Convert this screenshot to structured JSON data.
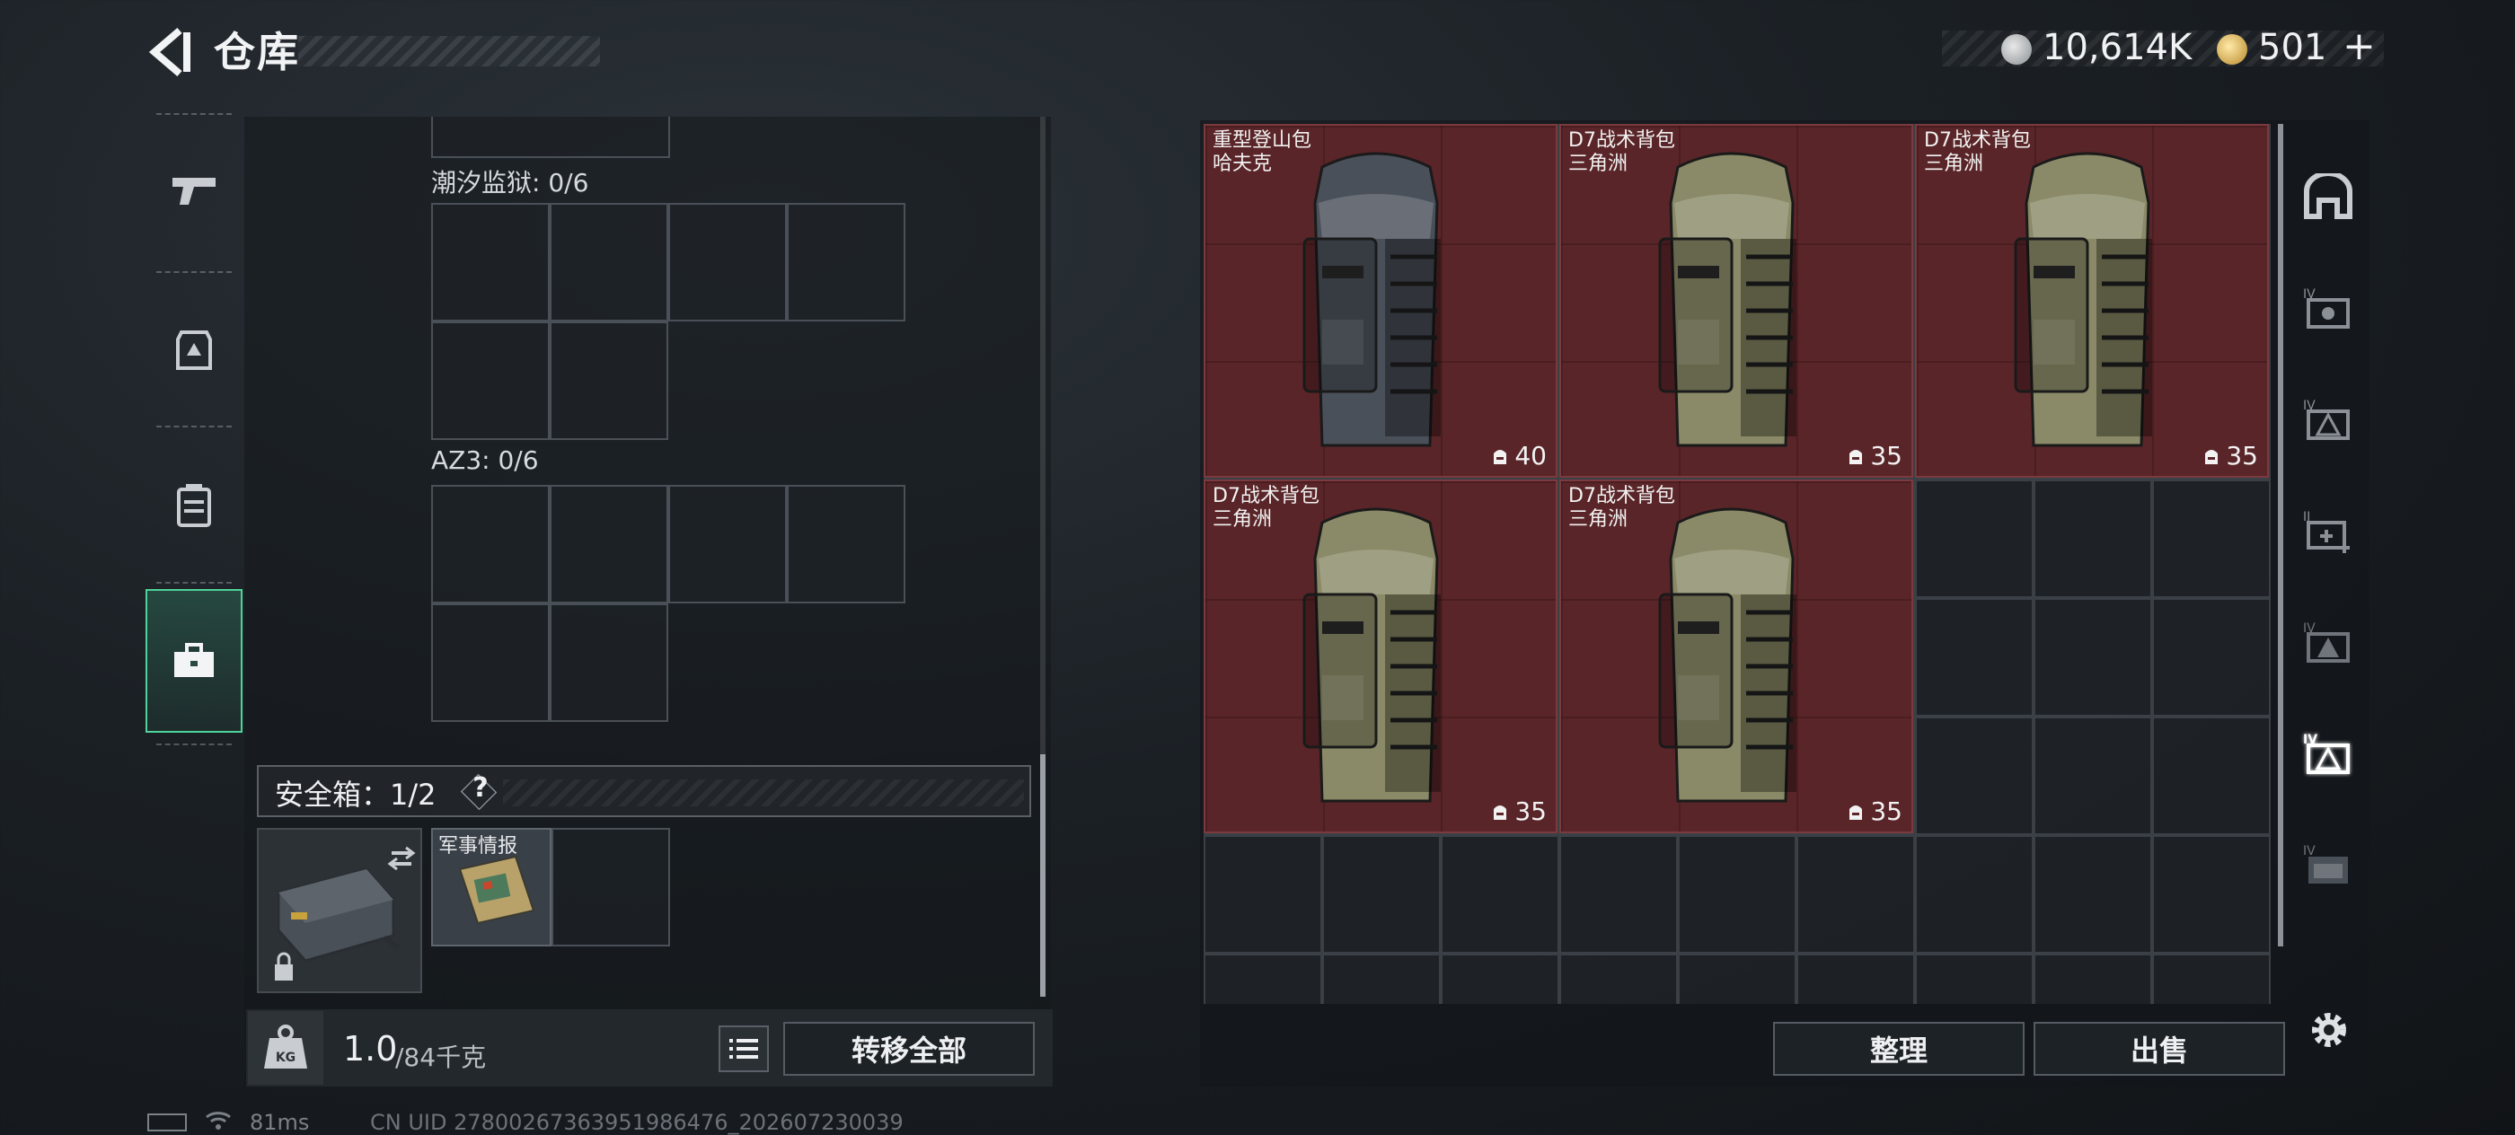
{
  "header": {
    "title": "仓库",
    "currency_primary": "10,614K",
    "currency_secondary": "501",
    "currency_secondary_plus": "+"
  },
  "left_nav": [
    "weapons-icon",
    "armor-icon",
    "backpack-icon",
    "toolbox-icon"
  ],
  "containers": {
    "grid1_label": "潮汐监狱: 0/6",
    "grid2_label": "AZ3: 0/6",
    "safebox_label": "安全箱：1/2",
    "safebox_help": "?",
    "safebox_item_label": "军事情报"
  },
  "capacity": {
    "current": "1.0",
    "max": "/84千克",
    "transfer_all": "转移全部"
  },
  "stash": {
    "items": [
      {
        "name": "重型登山包",
        "sub": "哈夫克",
        "capacity": "40",
        "color": "#4a505a"
      },
      {
        "name": "D7战术背包",
        "sub": "三角洲",
        "capacity": "35",
        "color": "#8a8a68"
      },
      {
        "name": "D7战术背包",
        "sub": "三角洲",
        "capacity": "35",
        "color": "#8a8a68"
      },
      {
        "name": "D7战术背包",
        "sub": "三角洲",
        "capacity": "35",
        "color": "#8a8a68"
      },
      {
        "name": "D7战术背包",
        "sub": "三角洲",
        "capacity": "35",
        "color": "#8a8a68"
      }
    ],
    "tidy_label": "整理",
    "sell_label": "出售",
    "accent": "#5a2528"
  },
  "footer": {
    "ping": "81ms",
    "uid": "CN UID 27800267363951986476_202607230039"
  }
}
